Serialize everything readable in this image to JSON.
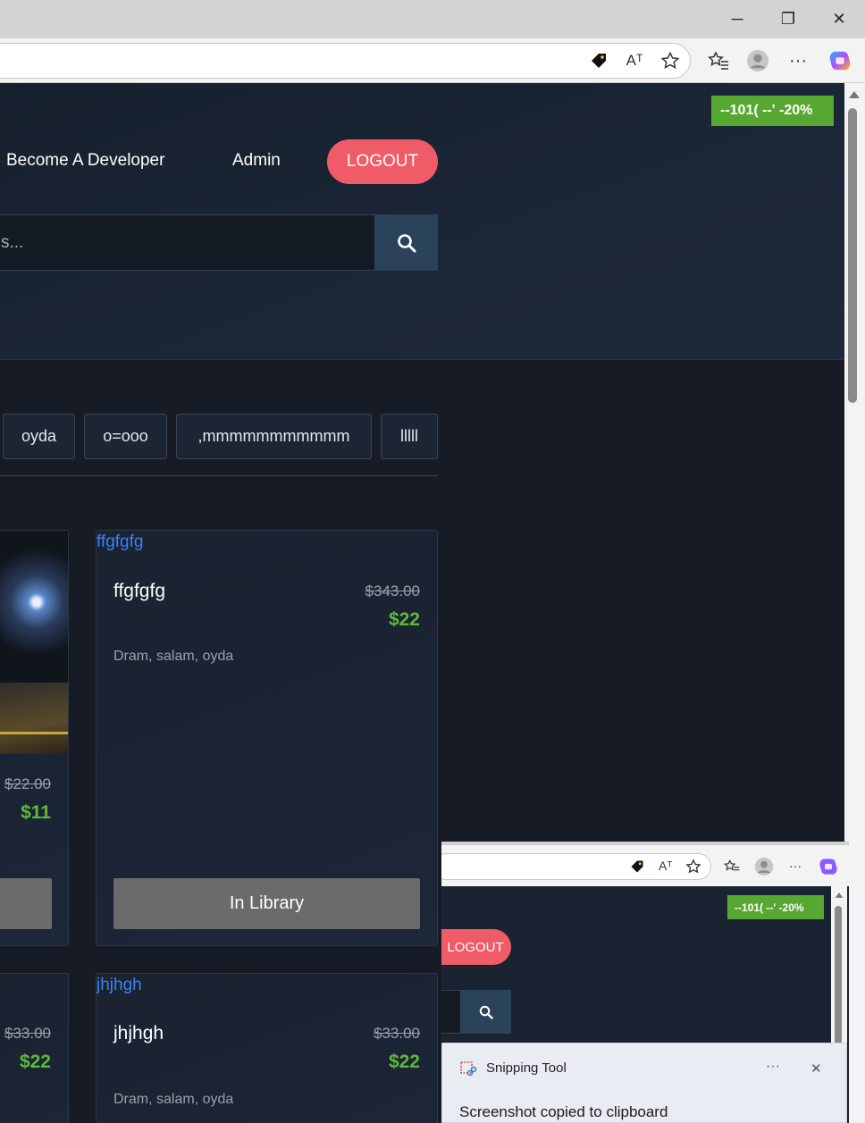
{
  "browser": {
    "window_controls": {
      "minimize": "─",
      "restore": "❐",
      "close": "✕"
    },
    "toolbar_icons": [
      "tag-icon",
      "read-aloud-icon",
      "favorite-star-icon",
      "favorites-icon",
      "profile-icon",
      "more-icon",
      "copilot-icon"
    ],
    "read_aloud": "Aᵀ",
    "more": "···"
  },
  "promo_badge": "--101( --' -20%",
  "nav": {
    "become_developer": "Become A Developer",
    "admin": "Admin",
    "logout": "LOGOUT"
  },
  "search": {
    "placeholder": "s..."
  },
  "tags": [
    "oyda",
    "o=ooo",
    ",mmmmmmmmmmm",
    "lllll"
  ],
  "cards": [
    {
      "title": "",
      "old_price": "$22.00",
      "new_price": "$11",
      "button": ""
    },
    {
      "image_alt": "ffgfgfg",
      "title": "ffgfgfg",
      "old_price": "$343.00",
      "new_price": "$22",
      "tags": "Dram, salam, oyda",
      "button": "In Library"
    },
    {
      "old_price": "$33.00",
      "new_price": "$22"
    },
    {
      "image_alt": "jhjhgh",
      "title": "jhjhgh",
      "old_price": "$33.00",
      "new_price": "$22",
      "tags": "Dram, salam, oyda"
    }
  ],
  "mini_screenshot": {
    "promo_badge": "--101( --' -20%",
    "logout": "LOGOUT"
  },
  "toast": {
    "app_name": "Snipping Tool",
    "message": "Screenshot copied to clipboard",
    "more": "···",
    "close": "✕"
  },
  "colors": {
    "accent_green": "#57a832",
    "price_green": "#5fb83a",
    "logout_red": "#ef5b67",
    "page_bg": "#171b25"
  }
}
